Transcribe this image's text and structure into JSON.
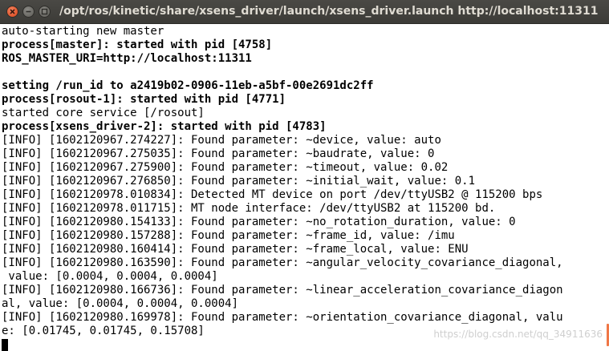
{
  "window": {
    "title": "/opt/ros/kinetic/share/xsens_driver/launch/xsens_driver.launch http://localhost:11311",
    "controls": [
      "close-icon",
      "minimize-icon",
      "maximize-icon"
    ]
  },
  "terminal": {
    "lines": [
      {
        "text": "auto-starting new master",
        "bold": false
      },
      {
        "text": "process[master]: started with pid [4758]",
        "bold": true
      },
      {
        "text": "ROS_MASTER_URI=http://localhost:11311",
        "bold": true
      },
      {
        "text": "",
        "bold": false
      },
      {
        "text": "setting /run_id to a2419b02-0906-11eb-a5bf-00e2691dc2ff",
        "bold": true
      },
      {
        "text": "process[rosout-1]: started with pid [4771]",
        "bold": true
      },
      {
        "text": "started core service [/rosout]",
        "bold": false
      },
      {
        "text": "process[xsens_driver-2]: started with pid [4783]",
        "bold": true
      },
      {
        "text": "[INFO] [1602120967.274227]: Found parameter: ~device, value: auto",
        "bold": false
      },
      {
        "text": "[INFO] [1602120967.275035]: Found parameter: ~baudrate, value: 0",
        "bold": false
      },
      {
        "text": "[INFO] [1602120967.275900]: Found parameter: ~timeout, value: 0.02",
        "bold": false
      },
      {
        "text": "[INFO] [1602120967.276850]: Found parameter: ~initial_wait, value: 0.1",
        "bold": false
      },
      {
        "text": "[INFO] [1602120978.010834]: Detected MT device on port /dev/ttyUSB2 @ 115200 bps",
        "bold": false
      },
      {
        "text": "[INFO] [1602120978.011715]: MT node interface: /dev/ttyUSB2 at 115200 bd.",
        "bold": false
      },
      {
        "text": "[INFO] [1602120980.154133]: Found parameter: ~no_rotation_duration, value: 0",
        "bold": false
      },
      {
        "text": "[INFO] [1602120980.157288]: Found parameter: ~frame_id, value: /imu",
        "bold": false
      },
      {
        "text": "[INFO] [1602120980.160414]: Found parameter: ~frame_local, value: ENU",
        "bold": false
      },
      {
        "text": "[INFO] [1602120980.163590]: Found parameter: ~angular_velocity_covariance_diagonal,",
        "bold": false
      },
      {
        "text": " value: [0.0004, 0.0004, 0.0004]",
        "bold": false
      },
      {
        "text": "[INFO] [1602120980.166736]: Found parameter: ~linear_acceleration_covariance_diagon",
        "bold": false
      },
      {
        "text": "al, value: [0.0004, 0.0004, 0.0004]",
        "bold": false
      },
      {
        "text": "[INFO] [1602120980.169978]: Found parameter: ~orientation_covariance_diagonal, valu",
        "bold": false
      },
      {
        "text": "e: [0.01745, 0.01745, 0.15708]",
        "bold": false
      }
    ],
    "cursor": "block-cursor"
  },
  "watermark": "https://blog.csdn.net/qq_34911636",
  "colors": {
    "titlebar": "#3c3b37",
    "title_text": "#dfdbd2",
    "close_button": "#e0562d",
    "terminal_background": "#ffffff",
    "terminal_text": "#000000",
    "scroll_thumb": "#f07746"
  }
}
